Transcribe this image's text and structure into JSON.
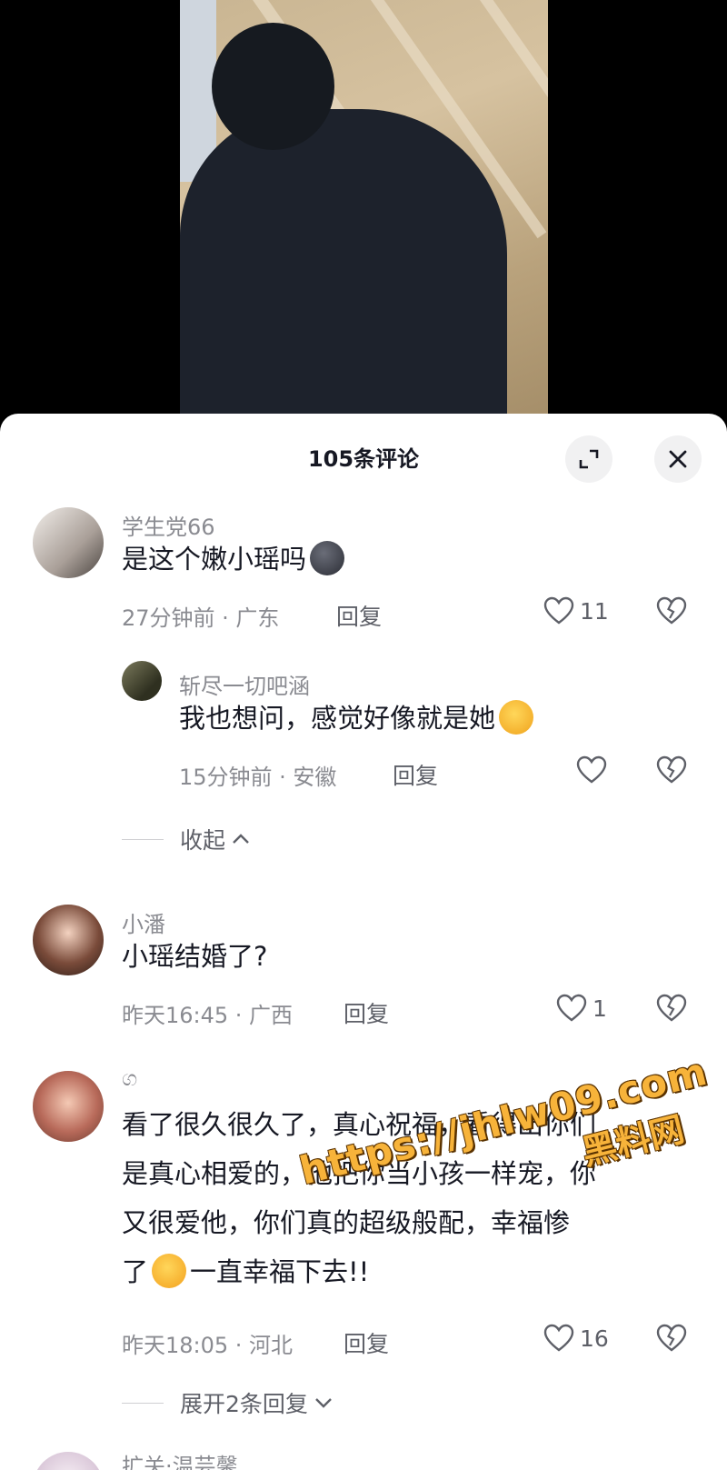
{
  "header": {
    "title": "105条评论",
    "expand_icon": "expand-icon",
    "close_icon": "close-icon"
  },
  "comments": [
    {
      "user": "学生党66",
      "text": "是这个嫩小瑶吗",
      "emoji": "face-emoji",
      "time_location": "27分钟前 · 广东",
      "reply_label": "回复",
      "likes": "11"
    },
    {
      "user": "斩尽一切吧涵",
      "text": "我也想问，感觉好像就是她",
      "emoji": "laughing-emoji",
      "time_location": "15分钟前 · 安徽",
      "reply_label": "回复",
      "likes": ""
    },
    {
      "user": "小潘",
      "text": "小瑶结婚了?",
      "time_location": "昨天16:45 · 广西",
      "reply_label": "回复",
      "likes": "1"
    },
    {
      "user": "ග",
      "text_lines": [
        "看了很久很久了，真心祝福，看得出你们",
        "是真心相爱的，他把你当小孩一样宠，你",
        "又很爱他，你们真的超级般配，幸福惨",
        "了",
        "一直幸福下去!!"
      ],
      "emoji": "crying-emoji",
      "time_location": "昨天18:05 · 河北",
      "reply_label": "回复",
      "likes": "16"
    },
    {
      "user": "扩关·温芸馨"
    }
  ],
  "fold": {
    "collapse_label": "收起",
    "expand_label": "展开2条回复"
  },
  "watermark": {
    "url": "https://jhlw09.com",
    "name": "黑料网"
  },
  "colors": {
    "background": "#ffffff",
    "muted_text": "#8a8b91",
    "primary_text": "#161823",
    "watermark": "#f7b33a"
  }
}
